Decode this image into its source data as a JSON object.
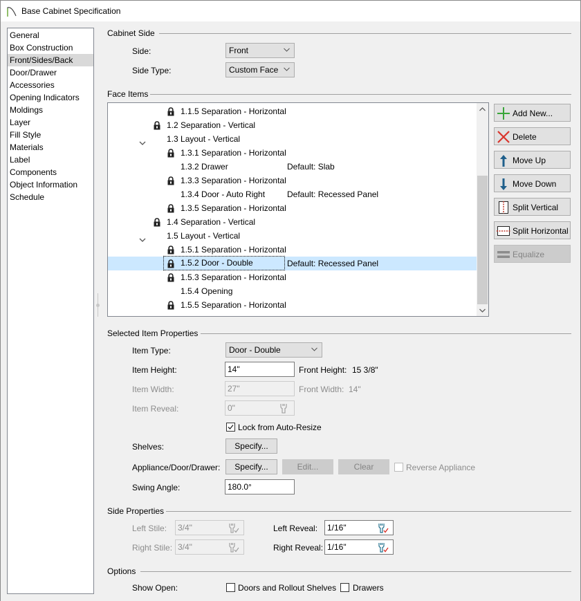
{
  "window": {
    "title": "Base Cabinet Specification"
  },
  "sidebar": {
    "items": [
      {
        "label": "General",
        "active": false
      },
      {
        "label": "Box Construction",
        "active": false
      },
      {
        "label": "Front/Sides/Back",
        "active": true
      },
      {
        "label": "Door/Drawer",
        "active": false
      },
      {
        "label": "Accessories",
        "active": false
      },
      {
        "label": "Opening Indicators",
        "active": false
      },
      {
        "label": "Moldings",
        "active": false
      },
      {
        "label": "Layer",
        "active": false
      },
      {
        "label": "Fill Style",
        "active": false
      },
      {
        "label": "Materials",
        "active": false
      },
      {
        "label": "Label",
        "active": false
      },
      {
        "label": "Components",
        "active": false
      },
      {
        "label": "Object Information",
        "active": false
      },
      {
        "label": "Schedule",
        "active": false
      }
    ]
  },
  "cabinet_side": {
    "group_label": "Cabinet Side",
    "side_label": "Side:",
    "side_value": "Front",
    "side_type_label": "Side Type:",
    "side_type_value": "Custom Face"
  },
  "face_items": {
    "group_label": "Face Items",
    "scroll_fraction_visible": 0.62,
    "rows": [
      {
        "label": "1.1.5 Separation - Horizontal",
        "level": 3,
        "locked": true,
        "expander": false,
        "default": "",
        "selected": false
      },
      {
        "label": "1.2 Separation - Vertical",
        "level": 2,
        "locked": true,
        "expander": false,
        "default": "",
        "selected": false
      },
      {
        "label": "1.3 Layout - Vertical",
        "level": 2,
        "locked": false,
        "expander": true,
        "default": "",
        "selected": false
      },
      {
        "label": "1.3.1 Separation - Horizontal",
        "level": 3,
        "locked": true,
        "expander": false,
        "default": "",
        "selected": false
      },
      {
        "label": "1.3.2 Drawer",
        "level": 3,
        "locked": false,
        "expander": false,
        "default": "Default: Slab",
        "selected": false
      },
      {
        "label": "1.3.3 Separation - Horizontal",
        "level": 3,
        "locked": true,
        "expander": false,
        "default": "",
        "selected": false
      },
      {
        "label": "1.3.4 Door - Auto Right",
        "level": 3,
        "locked": false,
        "expander": false,
        "default": "Default: Recessed Panel",
        "selected": false
      },
      {
        "label": "1.3.5 Separation - Horizontal",
        "level": 3,
        "locked": true,
        "expander": false,
        "default": "",
        "selected": false
      },
      {
        "label": "1.4 Separation - Vertical",
        "level": 2,
        "locked": true,
        "expander": false,
        "default": "",
        "selected": false
      },
      {
        "label": "1.5 Layout - Vertical",
        "level": 2,
        "locked": false,
        "expander": true,
        "default": "",
        "selected": false
      },
      {
        "label": "1.5.1 Separation - Horizontal",
        "level": 3,
        "locked": true,
        "expander": false,
        "default": "",
        "selected": false
      },
      {
        "label": "1.5.2 Door - Double",
        "level": 3,
        "locked": true,
        "expander": false,
        "default": "Default: Recessed Panel",
        "selected": true
      },
      {
        "label": "1.5.3 Separation - Horizontal",
        "level": 3,
        "locked": true,
        "expander": false,
        "default": "",
        "selected": false
      },
      {
        "label": "1.5.4 Opening",
        "level": 3,
        "locked": false,
        "expander": false,
        "default": "",
        "selected": false
      },
      {
        "label": "1.5.5 Separation - Horizontal",
        "level": 3,
        "locked": true,
        "expander": false,
        "default": "",
        "selected": false
      }
    ],
    "buttons": {
      "add_new": "Add New...",
      "delete": "Delete",
      "move_up": "Move Up",
      "move_down": "Move Down",
      "split_vertical": "Split Vertical",
      "split_horizontal": "Split Horizontal",
      "equalize": "Equalize"
    }
  },
  "selected_item": {
    "group_label": "Selected Item Properties",
    "item_type_label": "Item Type:",
    "item_type_value": "Door - Double",
    "item_height_label": "Item Height:",
    "item_height_value": "14\"",
    "front_height_label": "Front Height:",
    "front_height_value": "15 3/8\"",
    "item_width_label": "Item Width:",
    "item_width_value": "27\"",
    "front_width_label": "Front Width:",
    "front_width_value": "14\"",
    "item_reveal_label": "Item Reveal:",
    "item_reveal_value": "0\"",
    "lock_auto_resize_label": "Lock from Auto-Resize",
    "lock_auto_resize_checked": true,
    "shelves_label": "Shelves:",
    "shelves_button": "Specify...",
    "appliance_label": "Appliance/Door/Drawer:",
    "appliance_specify": "Specify...",
    "appliance_edit": "Edit...",
    "appliance_clear": "Clear",
    "reverse_appliance_label": "Reverse Appliance",
    "reverse_appliance_checked": false,
    "swing_angle_label": "Swing Angle:",
    "swing_angle_value": "180.0°"
  },
  "side_properties": {
    "group_label": "Side Properties",
    "left_stile_label": "Left Stile:",
    "left_stile_value": "3/4\"",
    "right_stile_label": "Right Stile:",
    "right_stile_value": "3/4\"",
    "left_reveal_label": "Left Reveal:",
    "left_reveal_value": "1/16\"",
    "right_reveal_label": "Right Reveal:",
    "right_reveal_value": "1/16\""
  },
  "options": {
    "group_label": "Options",
    "show_open_label": "Show Open:",
    "doors_rollout_label": "Doors and Rollout Shelves",
    "doors_rollout_checked": false,
    "drawers_label": "Drawers",
    "drawers_checked": false
  },
  "colors": {
    "selection": "#cce8ff",
    "add_icon": "#3aa63a",
    "delete_icon": "#d9342b",
    "move_icon": "#1f5f8b",
    "split_line": "#c0392b"
  }
}
